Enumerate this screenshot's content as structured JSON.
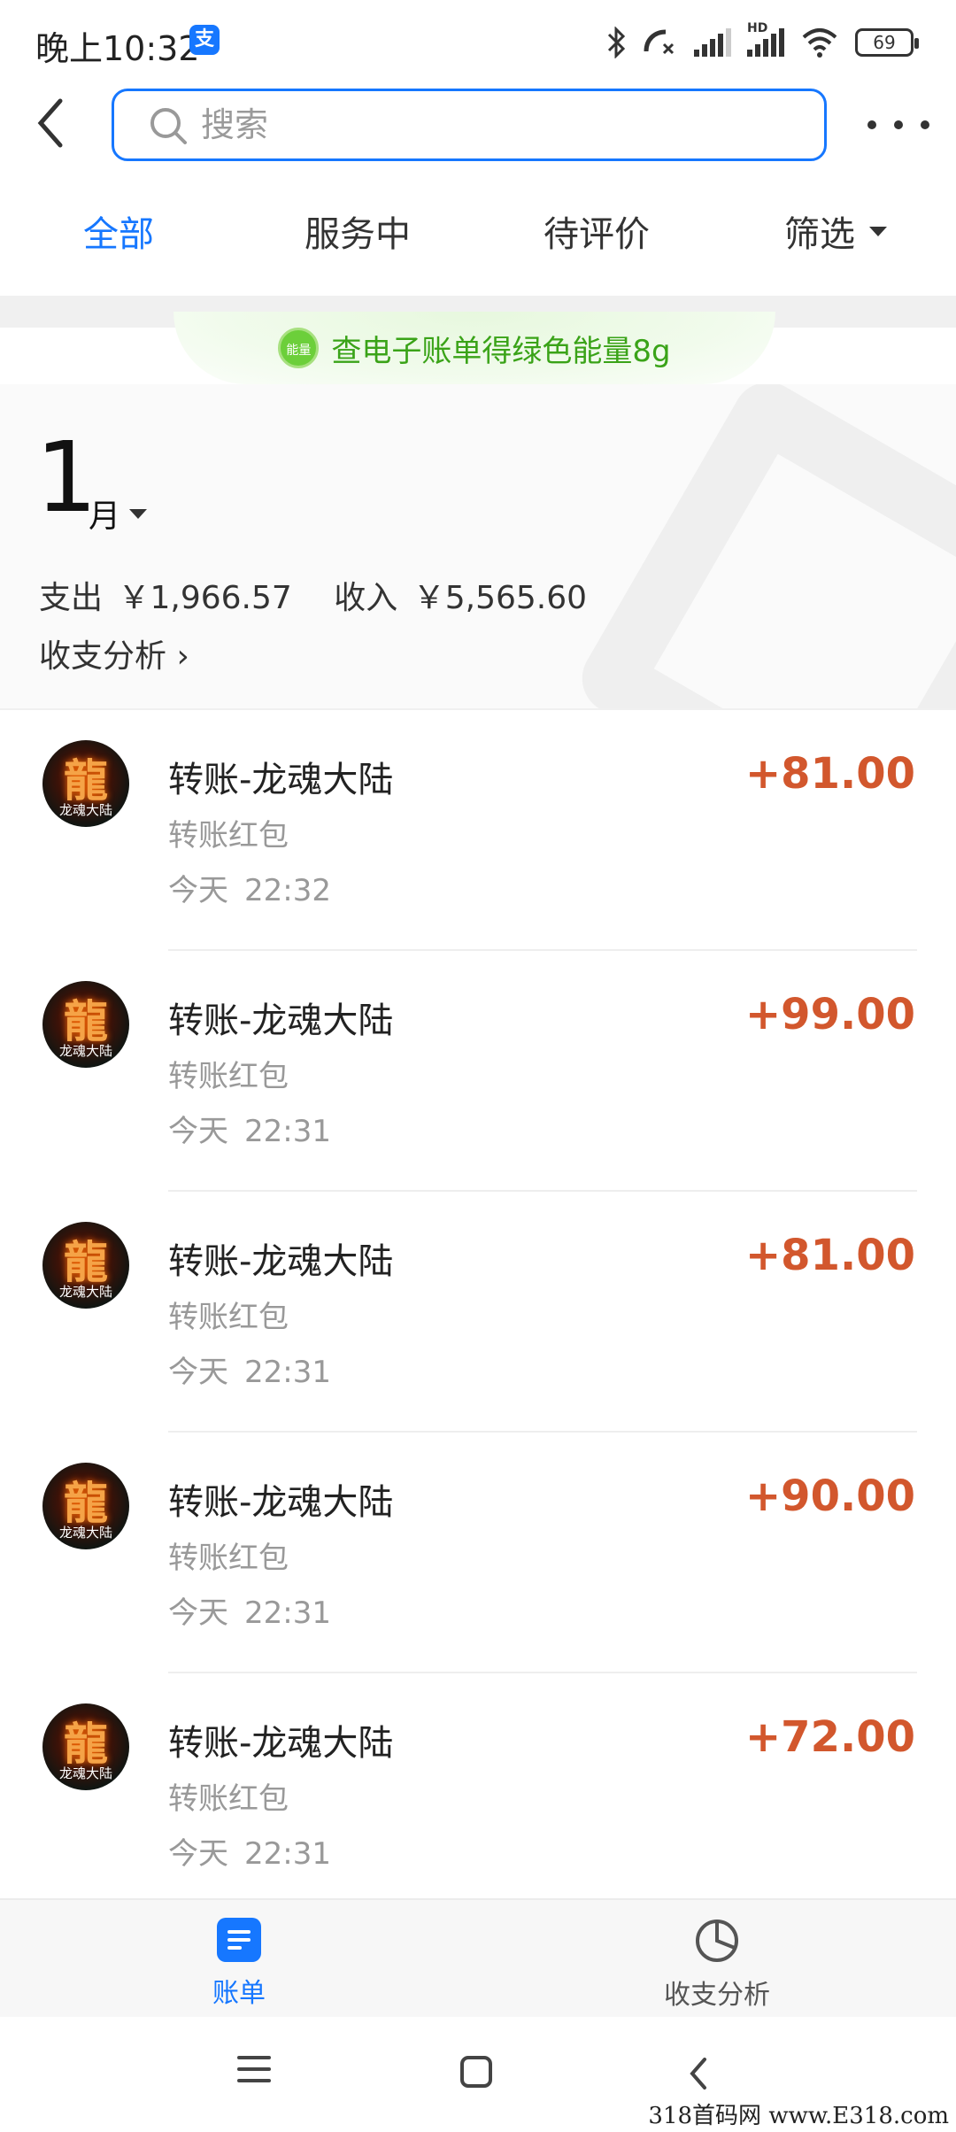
{
  "status_bar": {
    "time": "晚上10:32",
    "battery": "69",
    "hd_label": "HD"
  },
  "header": {
    "search_placeholder": "搜索"
  },
  "tabs": [
    {
      "label": "全部",
      "active": true
    },
    {
      "label": "服务中",
      "active": false
    },
    {
      "label": "待评价",
      "active": false
    },
    {
      "label": "筛选",
      "active": false
    }
  ],
  "energy_banner": {
    "badge": "能量",
    "text": "查电子账单得绿色能量8g"
  },
  "summary": {
    "month_number": "1",
    "month_unit": "月",
    "expense_label": "支出",
    "expense_value": "￥1,966.57",
    "income_label": "收入",
    "income_value": "￥5,565.60",
    "analysis_link": "收支分析 ›"
  },
  "transactions": [
    {
      "title": "转账-龙魂大陆",
      "subtitle": "转账红包",
      "day": "今天",
      "time": "22:32",
      "amount": "+81.00",
      "avatar_glyph": "龍",
      "avatar_caption": "龙魂大陆"
    },
    {
      "title": "转账-龙魂大陆",
      "subtitle": "转账红包",
      "day": "今天",
      "time": "22:31",
      "amount": "+99.00",
      "avatar_glyph": "龍",
      "avatar_caption": "龙魂大陆"
    },
    {
      "title": "转账-龙魂大陆",
      "subtitle": "转账红包",
      "day": "今天",
      "time": "22:31",
      "amount": "+81.00",
      "avatar_glyph": "龍",
      "avatar_caption": "龙魂大陆"
    },
    {
      "title": "转账-龙魂大陆",
      "subtitle": "转账红包",
      "day": "今天",
      "time": "22:31",
      "amount": "+90.00",
      "avatar_glyph": "龍",
      "avatar_caption": "龙魂大陆"
    },
    {
      "title": "转账-龙魂大陆",
      "subtitle": "转账红包",
      "day": "今天",
      "time": "22:31",
      "amount": "+72.00",
      "avatar_glyph": "龍",
      "avatar_caption": "龙魂大陆"
    }
  ],
  "bottom_tabs": {
    "bills": "账单",
    "analysis": "收支分析"
  },
  "watermark": "318首码网 www.E318.com",
  "colors": {
    "accent": "#1677ff",
    "amount": "#d2572d",
    "energy_green": "#3aa318"
  }
}
